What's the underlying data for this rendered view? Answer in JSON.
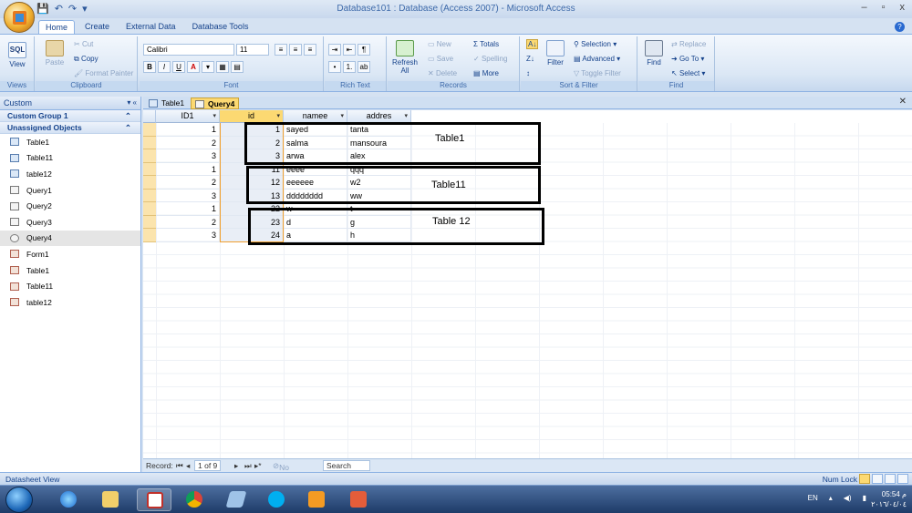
{
  "window": {
    "title": "Database101 : Database (Access 2007) - Microsoft Access",
    "controls": [
      "–",
      "▫",
      "x"
    ]
  },
  "ribbon_tabs": [
    "Home",
    "Create",
    "External Data",
    "Database Tools"
  ],
  "ribbon": {
    "views": {
      "label": "Views",
      "view": "View"
    },
    "clipboard": {
      "label": "Clipboard",
      "paste": "Paste",
      "cut": "Cut",
      "copy": "Copy",
      "format_painter": "Format Painter"
    },
    "font": {
      "label": "Font",
      "font_name": "Calibri",
      "font_size": "11",
      "bold": "B",
      "italic": "I",
      "underline": "U"
    },
    "rich_text": {
      "label": "Rich Text"
    },
    "records": {
      "label": "Records",
      "refresh": "Refresh All",
      "new": "New",
      "save": "Save",
      "delete": "Delete",
      "totals": "Totals",
      "spelling": "Spelling",
      "more": "More"
    },
    "sort_filter": {
      "label": "Sort & Filter",
      "filter": "Filter",
      "selection": "Selection",
      "advanced": "Advanced",
      "toggle_filter": "Toggle Filter"
    },
    "find": {
      "label": "Find",
      "find": "Find",
      "replace": "Replace",
      "goto": "Go To",
      "select": "Select"
    }
  },
  "nav": {
    "header": "Custom",
    "groups": [
      {
        "label": "Custom Group 1"
      },
      {
        "label": "Unassigned Objects"
      }
    ],
    "items": [
      {
        "label": "Table1",
        "type": "table"
      },
      {
        "label": "Table11",
        "type": "table"
      },
      {
        "label": "table12",
        "type": "table"
      },
      {
        "label": "Query1",
        "type": "query"
      },
      {
        "label": "Query2",
        "type": "query"
      },
      {
        "label": "Query3",
        "type": "query"
      },
      {
        "label": "Query4",
        "type": "query"
      },
      {
        "label": "Form1",
        "type": "form"
      },
      {
        "label": "Table1",
        "type": "form"
      },
      {
        "label": "Table11",
        "type": "form"
      },
      {
        "label": "table12",
        "type": "form"
      }
    ]
  },
  "doc_tabs": [
    "Table1",
    "Query4"
  ],
  "grid": {
    "columns": [
      "ID1",
      "id",
      "namee",
      "addres"
    ],
    "rows": [
      [
        "1",
        "1",
        "sayed",
        "tanta"
      ],
      [
        "2",
        "2",
        "salma",
        "mansoura"
      ],
      [
        "3",
        "3",
        "arwa",
        "alex"
      ],
      [
        "1",
        "11",
        "eeee",
        "qqq"
      ],
      [
        "2",
        "12",
        "eeeeee",
        "w2"
      ],
      [
        "3",
        "13",
        "dddddddd",
        "ww"
      ],
      [
        "1",
        "22",
        "w",
        "t"
      ],
      [
        "2",
        "23",
        "d",
        "g"
      ],
      [
        "3",
        "24",
        "a",
        "h"
      ]
    ]
  },
  "annotations": [
    "Table1",
    "Table11",
    "Table 12"
  ],
  "record_nav": {
    "label": "Record:",
    "position": "1 of 9",
    "filter": "No Filter",
    "search": "Search"
  },
  "status": {
    "left": "Datasheet View",
    "right": "Num Lock"
  },
  "tray": {
    "lang": "EN",
    "time": "05:54 م",
    "date": "٢٠١٦/٠٤/٠٤"
  }
}
